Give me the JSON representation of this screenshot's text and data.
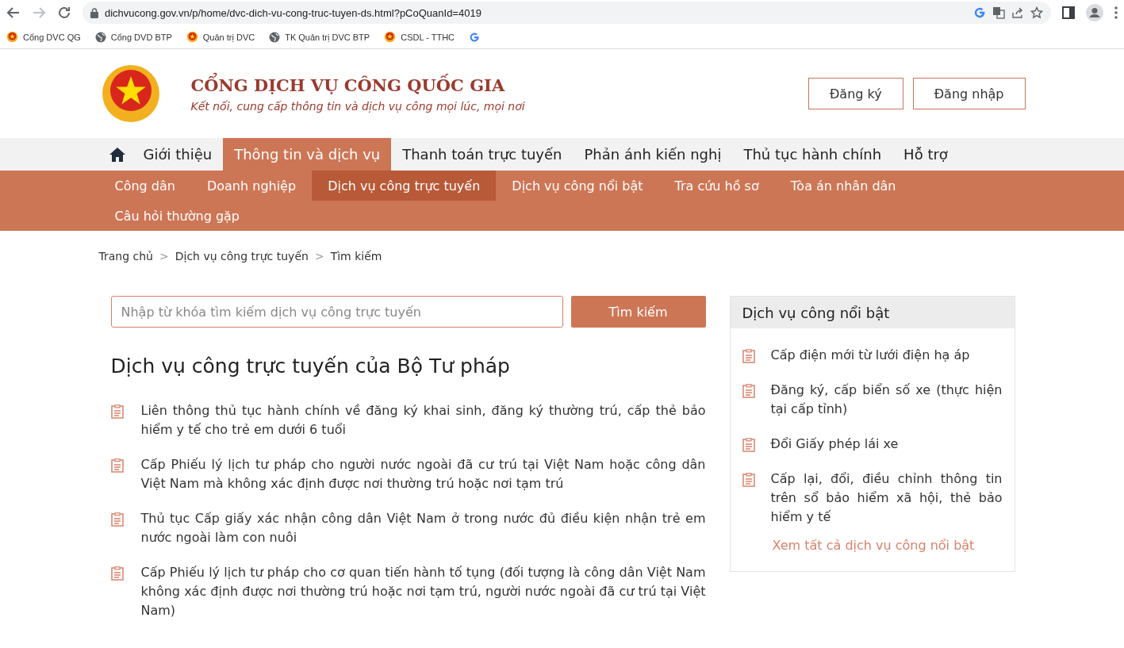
{
  "browser": {
    "url": "dichvucong.gov.vn/p/home/dvc-dich-vu-cong-truc-tuyen-ds.html?pCoQuanId=4019",
    "bookmarks": [
      {
        "label": "Cổng DVC QG",
        "kind": "emblem"
      },
      {
        "label": "Cổng DVD BTP",
        "kind": "globe"
      },
      {
        "label": "Quản trị DVC",
        "kind": "emblem"
      },
      {
        "label": "TK Quản trị DVC BTP",
        "kind": "globe"
      },
      {
        "label": "CSDL - TTHC",
        "kind": "emblem"
      },
      {
        "kind": "google"
      }
    ]
  },
  "header": {
    "title": "CỔNG DỊCH VỤ CÔNG QUỐC GIA",
    "tagline": "Kết nối, cung cấp thông tin và dịch vụ công mọi lúc, mọi nơi",
    "buttons": [
      "Đăng ký",
      "Đăng nhập"
    ]
  },
  "nav": [
    {
      "label": "Giới thiệu",
      "selected": false
    },
    {
      "label": "Thông tin và dịch vụ",
      "selected": true
    },
    {
      "label": "Thanh toán trực tuyến",
      "selected": false
    },
    {
      "label": "Phản ánh kiến nghị",
      "selected": false
    },
    {
      "label": "Thủ tục hành chính",
      "selected": false
    },
    {
      "label": "Hỗ trợ",
      "selected": false
    }
  ],
  "subnav": [
    {
      "label": "Công dân",
      "selected": false
    },
    {
      "label": "Doanh nghiệp",
      "selected": false
    },
    {
      "label": "Dịch vụ công trực tuyến",
      "selected": true
    },
    {
      "label": "Dịch vụ công nổi bật",
      "selected": false
    },
    {
      "label": "Tra cứu hồ sơ",
      "selected": false
    },
    {
      "label": "Tòa án nhân dân",
      "selected": false
    },
    {
      "label": "Câu hỏi thường gặp",
      "selected": false
    }
  ],
  "breadcrumb": [
    {
      "label": "Trang chủ"
    },
    {
      "separator": ">",
      "label": "Dịch vụ công trực tuyến"
    },
    {
      "separator": ">",
      "label": "Tìm kiếm"
    }
  ],
  "search": {
    "placeholder": "Nhập từ khóa tìm kiếm dịch vụ công trực tuyến",
    "button": "Tìm kiếm"
  },
  "main": {
    "title": "Dịch vụ công trực tuyến của Bộ Tư pháp",
    "items": [
      "Liên thông thủ tục hành chính về đăng ký khai sinh, đăng ký thường trú, cấp thẻ bảo hiểm y tế cho trẻ em dưới 6 tuổi",
      "Cấp Phiếu lý lịch tư pháp cho người nước ngoài đã cư trú tại Việt Nam hoặc công dân Việt Nam mà không xác định được nơi thường trú hoặc nơi tạm trú",
      "Thủ tục Cấp giấy xác nhận công dân Việt Nam ở trong nước đủ điều kiện nhận trẻ em nước ngoài làm con nuôi",
      "Cấp Phiếu lý lịch tư pháp cho cơ quan tiến hành tố tụng (đối tượng là công dân Việt Nam không xác định được nơi thường trú hoặc nơi tạm trú, người nước ngoài đã cư trú tại Việt Nam)"
    ]
  },
  "sidebar": {
    "title": "Dịch vụ công nổi bật",
    "items": [
      "Cấp điện mới từ lưới điện hạ áp",
      "Đăng ký, cấp biển số xe (thực hiện tại cấp tỉnh)",
      "Đổi Giấy phép lái xe",
      "Cấp lại, đổi, điều chỉnh thông tin trên sổ bảo hiểm xã hội, thẻ bảo hiểm y tế"
    ],
    "link": "Xem tất cả dịch vụ công nổi bật"
  }
}
